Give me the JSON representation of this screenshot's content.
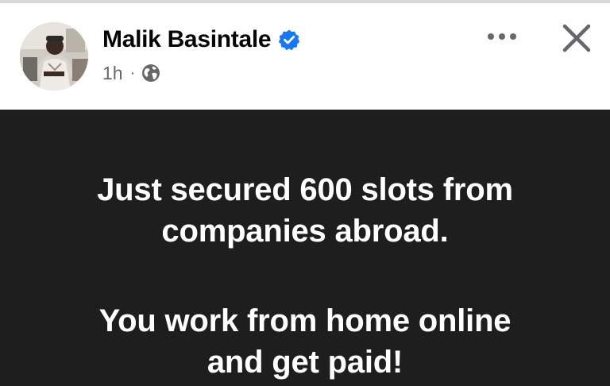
{
  "post": {
    "author": {
      "name": "Malik Basintale",
      "verified": true,
      "avatar_alt": "profile photo"
    },
    "timestamp": "1h",
    "separator": "·",
    "audience_icon": "globe-icon",
    "actions": {
      "more_icon": "more-horizontal-icon",
      "close_icon": "close-icon"
    },
    "background_color": "#1e1e1e",
    "text_color": "#ffffff",
    "verified_color": "#1877f2",
    "paragraphs": [
      [
        "Just secured 600 slots from",
        "companies abroad."
      ],
      [
        "You work from home online",
        "and get paid!"
      ]
    ]
  }
}
